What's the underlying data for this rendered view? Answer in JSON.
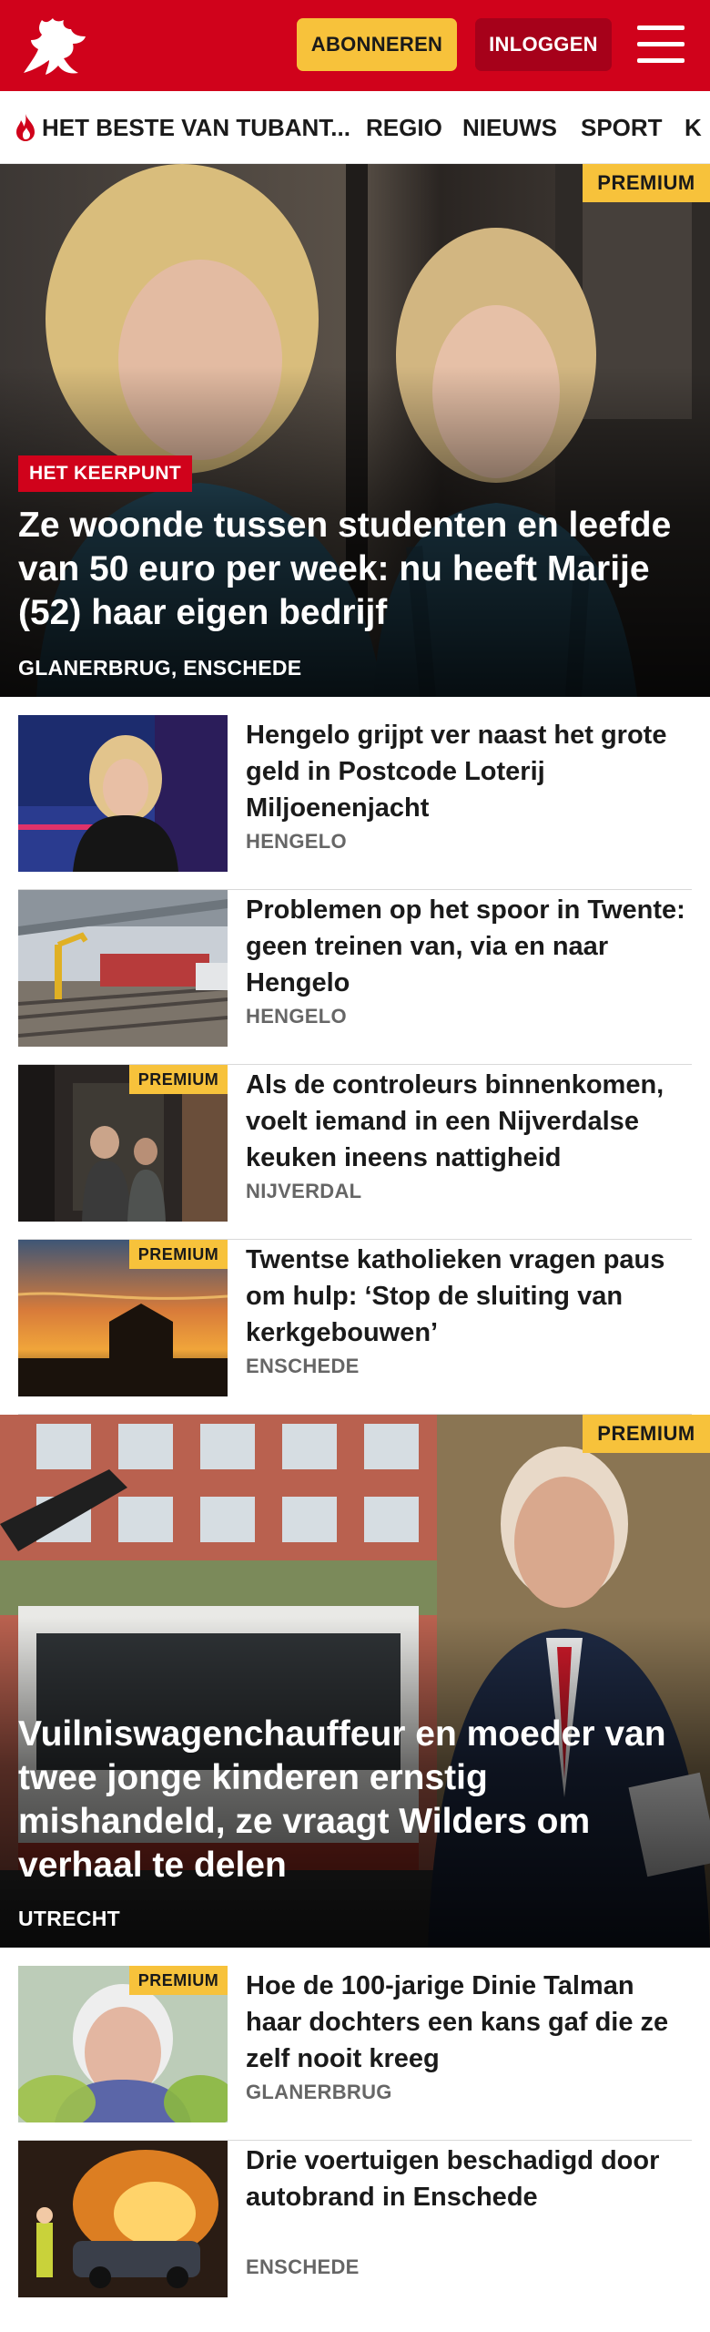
{
  "header": {
    "subscribe_label": "ABONNEREN",
    "login_label": "INLOGGEN",
    "brand_color": "#d0021b"
  },
  "nav": {
    "items": [
      {
        "label": "HET BESTE VAN TUBANT...",
        "icon": "flame-icon"
      },
      {
        "label": "REGIO"
      },
      {
        "label": "NIEUWS"
      },
      {
        "label": "SPORT"
      },
      {
        "label": "K"
      }
    ]
  },
  "premium_label": "PREMIUM",
  "hero1": {
    "kicker": "HET KEERPUNT",
    "title": "Ze woonde tussen studenten en leefde van 50 euro per week: nu heeft Marije (52) haar eigen bedrijf",
    "location": "GLANERBRUG, ENSCHEDE",
    "premium": true
  },
  "articles_a": [
    {
      "title": "Hengelo grijpt ver naast het grote geld in Postcode Loterij Miljoenenjacht",
      "location": "HENGELO",
      "premium": false
    },
    {
      "title": "Problemen op het spoor in Twente: geen treinen van, via en naar Hengelo",
      "location": "HENGELO",
      "premium": false
    },
    {
      "title": "Als de controleurs binnenkomen, voelt iemand in een Nijverdalse keuken ineens nattigheid",
      "location": "NIJVERDAL",
      "premium": true
    },
    {
      "title": "Twentse katholieken vragen paus om hulp: ‘Stop de sluiting van kerkgebouwen’",
      "location": "ENSCHEDE",
      "premium": true
    }
  ],
  "hero2": {
    "title": "Vuilniswagenchauffeur en moeder van twee jonge kinderen ernstig mishandeld, ze vraagt Wilders om verhaal te delen",
    "location": "UTRECHT",
    "premium": true
  },
  "articles_b": [
    {
      "title": "Hoe de 100-jarige Dinie Talman haar dochters een kans gaf die ze zelf nooit kreeg",
      "location": "GLANERBRUG",
      "premium": true
    },
    {
      "title": "Drie voertuigen beschadigd door autobrand in Enschede",
      "location": "ENSCHEDE",
      "premium": false
    }
  ]
}
